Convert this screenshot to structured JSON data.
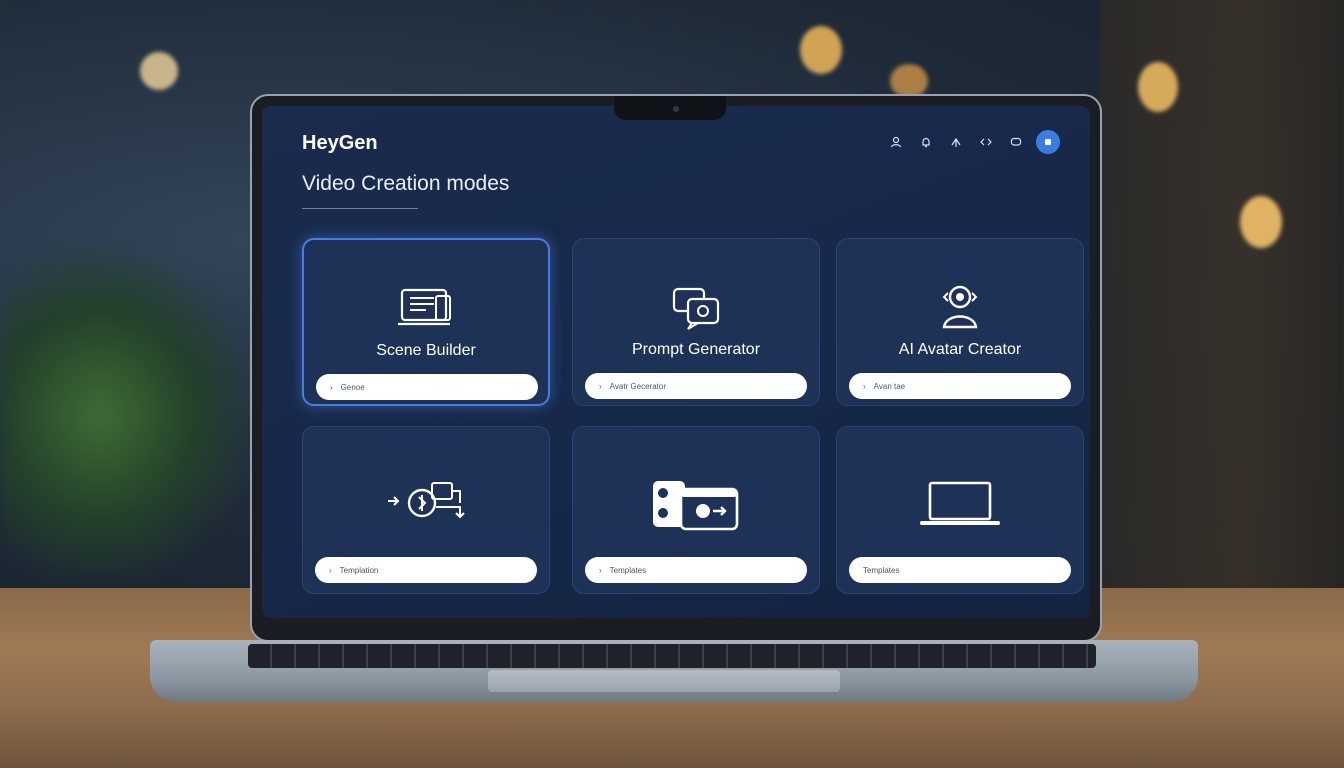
{
  "app": {
    "brand": "HeyGen",
    "page_title": "Video Creation modes",
    "toolbar_icons": [
      "user-icon",
      "bell-icon",
      "share-icon",
      "code-icon",
      "chat-icon"
    ],
    "avatar_icon": "profile-avatar-icon"
  },
  "cards": [
    {
      "label": "Scene Builder",
      "icon": "document-edit-icon",
      "pill_text": "Genoe",
      "active": true
    },
    {
      "label": "Prompt Generator",
      "icon": "chat-bubbles-icon",
      "pill_text": "Avatr Gecerator",
      "active": false
    },
    {
      "label": "AI Avatar Creator",
      "icon": "avatar-person-icon",
      "pill_text": "Avan tae",
      "active": false
    },
    {
      "label": "",
      "icon": "workflow-flow-icon",
      "pill_text": "Templation",
      "active": false
    },
    {
      "label": "",
      "icon": "media-cards-icon",
      "pill_text": "Templates",
      "active": false
    },
    {
      "label": "",
      "icon": "laptop-icon",
      "pill_text": "Templates",
      "active": false
    }
  ],
  "colors": {
    "accent": "#4a7ce0",
    "card_bg": "#1e3257",
    "screen_bg": "#17284a"
  }
}
